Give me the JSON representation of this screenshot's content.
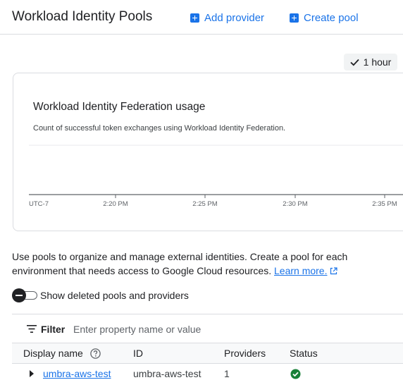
{
  "header": {
    "title": "Workload Identity Pools",
    "add_provider_label": "Add provider",
    "create_pool_label": "Create pool"
  },
  "time_range": {
    "selected": "1 hour"
  },
  "chart": {
    "title": "Workload Identity Federation usage",
    "subtitle": "Count of successful token exchanges using Workload Identity Federation.",
    "timezone_label": "UTC-7",
    "x_ticks": [
      "2:20 PM",
      "2:25 PM",
      "2:30 PM",
      "2:35 PM"
    ]
  },
  "chart_data": {
    "type": "line",
    "title": "Workload Identity Federation usage",
    "subtitle": "Count of successful token exchanges using Workload Identity Federation.",
    "x": [
      "UTC-7",
      "2:20 PM",
      "2:25 PM",
      "2:30 PM",
      "2:35 PM"
    ],
    "series": [],
    "grid": true
  },
  "description": {
    "text": "Use pools to organize and manage external identities. Create a pool for each environment that needs access to Google Cloud resources.",
    "link_label": "Learn more."
  },
  "toggle": {
    "label": "Show deleted pools and providers",
    "state": "off"
  },
  "filter": {
    "label": "Filter",
    "placeholder": "Enter property name or value"
  },
  "table": {
    "columns": [
      "Display name",
      "ID",
      "Providers",
      "Status"
    ],
    "rows": [
      {
        "display_name": "umbra-aws-test",
        "id": "umbra-aws-test",
        "providers": "1",
        "status_icon": "check-circle-icon"
      }
    ]
  },
  "colors": {
    "accent": "#1a73e8",
    "success": "#188038",
    "border": "#dadce0"
  }
}
